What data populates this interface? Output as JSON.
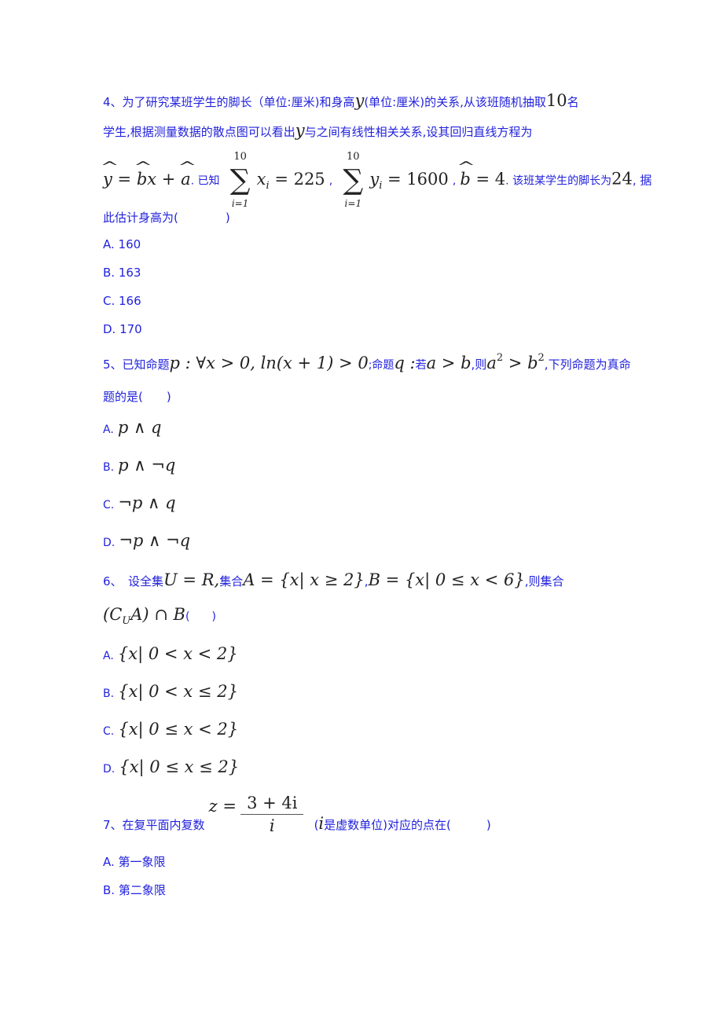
{
  "q4": {
    "line1_a": "4、为了研究某班学生的脚长（单位:厘米)和身高",
    "var_y": "y",
    "line1_b": "(单位:厘米)的关系,从该班随机抽取",
    "num_10": "10",
    "line1_c": "名",
    "line2_a": "学生,根据测量数据的散点图可以看出",
    "line2_b": "与之间有线性相关关系,设其回归直线方程为",
    "eq_regression": "y = bx + a",
    "known": ". 已知",
    "sum_upper": "10",
    "sum_lower": "i=1",
    "sum_x": "x",
    "sum_x_value": "= 225",
    "sum_y": "y",
    "sum_y_value": "= 1600",
    "comma": ",",
    "b_eq": "b = 4",
    "line3_b": ". 该班某学生的脚长为",
    "num_24": "24",
    "line3_c": ", 据",
    "line4": "此估计身高为(　　　　)",
    "options": [
      {
        "label": "A. 160"
      },
      {
        "label": "B. 163"
      },
      {
        "label": "C. 166"
      },
      {
        "label": "D. 170"
      }
    ]
  },
  "q5": {
    "line1_a": "5、已知命题",
    "p_stmt": "p : ∀x > 0, ln(x + 1) > 0",
    "line1_b": ";命题",
    "q_var": "q :",
    "line1_c": "若",
    "a_gt_b": "a > b",
    "line1_d": ",则",
    "a_sq": "a",
    "gt_b_sq": " > b",
    "sq": "2",
    "line1_e": ",下列命题为真命",
    "line2": "题的是(　　)",
    "options": [
      {
        "letter": "A.",
        "expr": "p ∧ q"
      },
      {
        "letter": "B.",
        "expr": "p ∧ ¬q"
      },
      {
        "letter": "C.",
        "expr": "¬p ∧ q"
      },
      {
        "letter": "D.",
        "expr": "¬p ∧ ¬q"
      }
    ]
  },
  "q6": {
    "line1_a": "6、　设全集",
    "u_eq": "U = R,",
    "line1_b": "集合",
    "set_a": "A = {x| x ≥ 2}",
    "comma": ",",
    "set_b": "B = {x| 0 ≤ x < 6}",
    "line1_c": ",则集合",
    "expr": "(C",
    "expr_sub": "U",
    "expr_rest": "A) ∩ B",
    "paren": "(　　)",
    "options": [
      {
        "letter": "A.",
        "expr": "{x| 0 < x < 2}"
      },
      {
        "letter": "B.",
        "expr": "{x| 0 < x ≤ 2}"
      },
      {
        "letter": "C.",
        "expr": "{x| 0 ≤ x < 2}"
      },
      {
        "letter": "D.",
        "expr": "{x| 0 ≤ x ≤ 2}"
      }
    ]
  },
  "q7": {
    "line1_a": "7、在复平面内复数",
    "z_eq": "z =",
    "numerator": "3 + 4i",
    "denominator": "i",
    "paren_open": "(",
    "i_var": "i",
    "line1_b": "是虚数单位)对应的点在(　　　)",
    "options": [
      {
        "label": "A. 第一象限"
      },
      {
        "label": "B. 第二象限"
      }
    ]
  }
}
